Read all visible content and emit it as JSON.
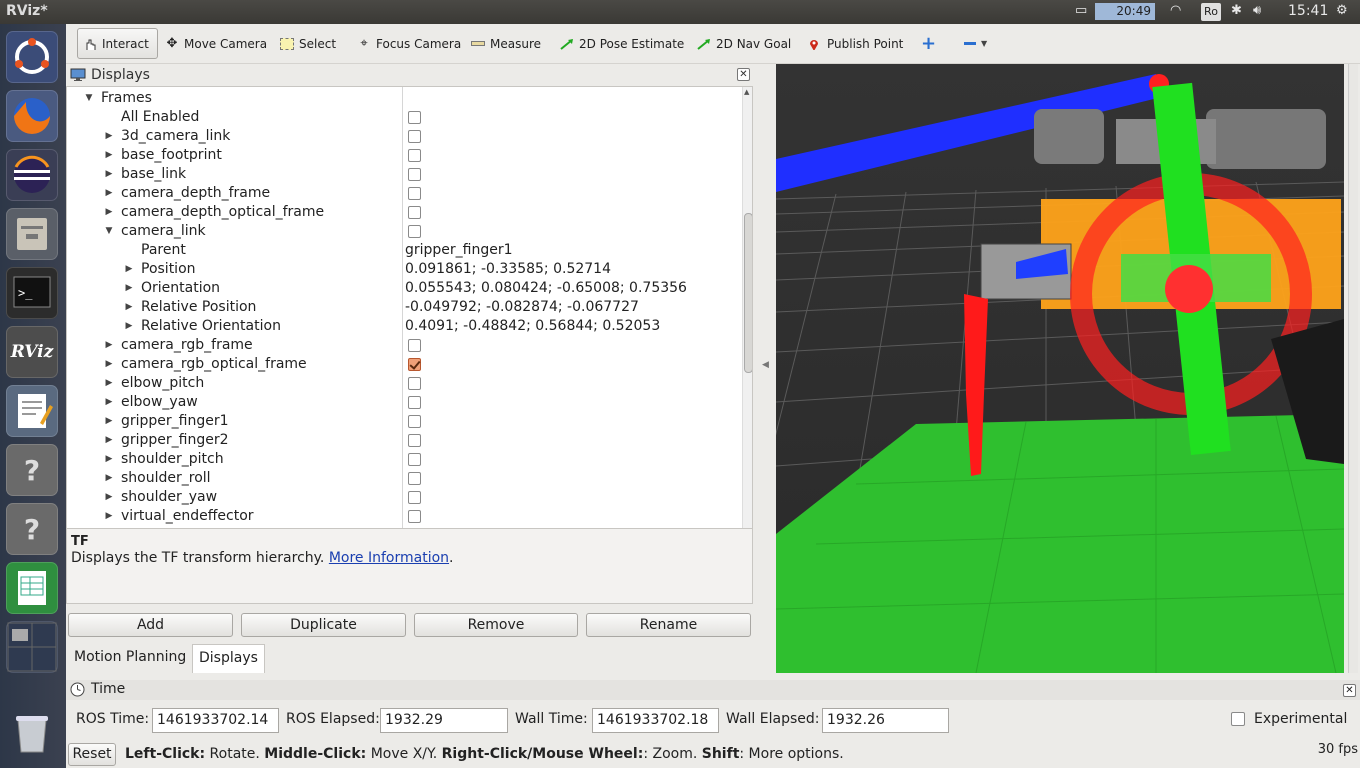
{
  "topbar": {
    "title": "RViz*",
    "counter": "20:49",
    "keyboard": "Ro",
    "clock": "15:41"
  },
  "launcher": {
    "items": [
      "ubuntu-dash",
      "firefox",
      "eclipse",
      "files",
      "terminal",
      "rviz",
      "text-editor",
      "help",
      "help",
      "spreadsheet",
      "workspaces",
      "trash"
    ],
    "rviz_label": "RViz"
  },
  "toolbar": {
    "tools": [
      {
        "label": "Interact",
        "icon": "hand-cursor-icon"
      },
      {
        "label": "Move Camera",
        "icon": "move-arrows-icon"
      },
      {
        "label": "Select",
        "icon": "select-box-icon"
      },
      {
        "label": "Focus Camera",
        "icon": "crosshair-icon"
      },
      {
        "label": "Measure",
        "icon": "ruler-icon"
      },
      {
        "label": "2D Pose Estimate",
        "icon": "green-arrow-icon"
      },
      {
        "label": "2D Nav Goal",
        "icon": "green-arrow-icon"
      },
      {
        "label": "Publish Point",
        "icon": "map-pin-icon"
      }
    ]
  },
  "displays": {
    "title": "Displays",
    "tree": [
      {
        "indent": 0,
        "arrow": "down",
        "label": "Frames",
        "value": "",
        "check": null
      },
      {
        "indent": 1,
        "arrow": "",
        "label": "All Enabled",
        "value": "",
        "check": false
      },
      {
        "indent": 1,
        "arrow": "right",
        "label": "3d_camera_link",
        "value": "",
        "check": false
      },
      {
        "indent": 1,
        "arrow": "right",
        "label": "base_footprint",
        "value": "",
        "check": false
      },
      {
        "indent": 1,
        "arrow": "right",
        "label": "base_link",
        "value": "",
        "check": false
      },
      {
        "indent": 1,
        "arrow": "right",
        "label": "camera_depth_frame",
        "value": "",
        "check": false
      },
      {
        "indent": 1,
        "arrow": "right",
        "label": "camera_depth_optical_frame",
        "value": "",
        "check": false
      },
      {
        "indent": 1,
        "arrow": "down",
        "label": "camera_link",
        "value": "",
        "check": false
      },
      {
        "indent": 2,
        "arrow": "",
        "label": "Parent",
        "value": "gripper_finger1",
        "check": null
      },
      {
        "indent": 2,
        "arrow": "right",
        "label": "Position",
        "value": "0.091861; -0.33585; 0.52714",
        "check": null
      },
      {
        "indent": 2,
        "arrow": "right",
        "label": "Orientation",
        "value": "0.055543; 0.080424; -0.65008; 0.75356",
        "check": null
      },
      {
        "indent": 2,
        "arrow": "right",
        "label": "Relative Position",
        "value": "-0.049792; -0.082874; -0.067727",
        "check": null
      },
      {
        "indent": 2,
        "arrow": "right",
        "label": "Relative Orientation",
        "value": "0.4091; -0.48842; 0.56844; 0.52053",
        "check": null
      },
      {
        "indent": 1,
        "arrow": "right",
        "label": "camera_rgb_frame",
        "value": "",
        "check": false
      },
      {
        "indent": 1,
        "arrow": "right",
        "label": "camera_rgb_optical_frame",
        "value": "",
        "check": true
      },
      {
        "indent": 1,
        "arrow": "right",
        "label": "elbow_pitch",
        "value": "",
        "check": false
      },
      {
        "indent": 1,
        "arrow": "right",
        "label": "elbow_yaw",
        "value": "",
        "check": false
      },
      {
        "indent": 1,
        "arrow": "right",
        "label": "gripper_finger1",
        "value": "",
        "check": false
      },
      {
        "indent": 1,
        "arrow": "right",
        "label": "gripper_finger2",
        "value": "",
        "check": false
      },
      {
        "indent": 1,
        "arrow": "right",
        "label": "shoulder_pitch",
        "value": "",
        "check": false
      },
      {
        "indent": 1,
        "arrow": "right",
        "label": "shoulder_roll",
        "value": "",
        "check": false
      },
      {
        "indent": 1,
        "arrow": "right",
        "label": "shoulder_yaw",
        "value": "",
        "check": false
      },
      {
        "indent": 1,
        "arrow": "right",
        "label": "virtual_endeffector",
        "value": "",
        "check": false
      }
    ],
    "description": {
      "heading": "TF",
      "text": "Displays the TF transform hierarchy.",
      "link": "More Information",
      "suffix": "."
    },
    "buttons": {
      "add": "Add",
      "duplicate": "Duplicate",
      "remove": "Remove",
      "rename": "Rename"
    },
    "tabs": [
      {
        "label": "Motion Planning",
        "selected": false
      },
      {
        "label": "Displays",
        "selected": true
      }
    ]
  },
  "time": {
    "title": "Time",
    "ros_time_label": "ROS Time:",
    "ros_time": "1461933702.14",
    "ros_elapsed_label": "ROS Elapsed:",
    "ros_elapsed": "1932.29",
    "wall_time_label": "Wall Time:",
    "wall_time": "1461933702.18",
    "wall_elapsed_label": "Wall Elapsed:",
    "wall_elapsed": "1932.26",
    "experimental_label": "Experimental"
  },
  "status": {
    "reset": "Reset",
    "hint_parts": [
      {
        "b": "Left-Click:",
        "t": " Rotate. "
      },
      {
        "b": "Middle-Click:",
        "t": " Move X/Y. "
      },
      {
        "b": "Right-Click/Mouse Wheel:",
        "t": ": Zoom. "
      },
      {
        "b": "Shift",
        "t": ": More options."
      }
    ],
    "fps": "30 fps"
  },
  "colors": {
    "ground": "#2fbf2f",
    "grid": "#5a5a5a",
    "x_axis": "#ff2020",
    "y_axis": "#20e020",
    "z_axis": "#1f3fff",
    "robot_orange": "#ffa31a"
  }
}
